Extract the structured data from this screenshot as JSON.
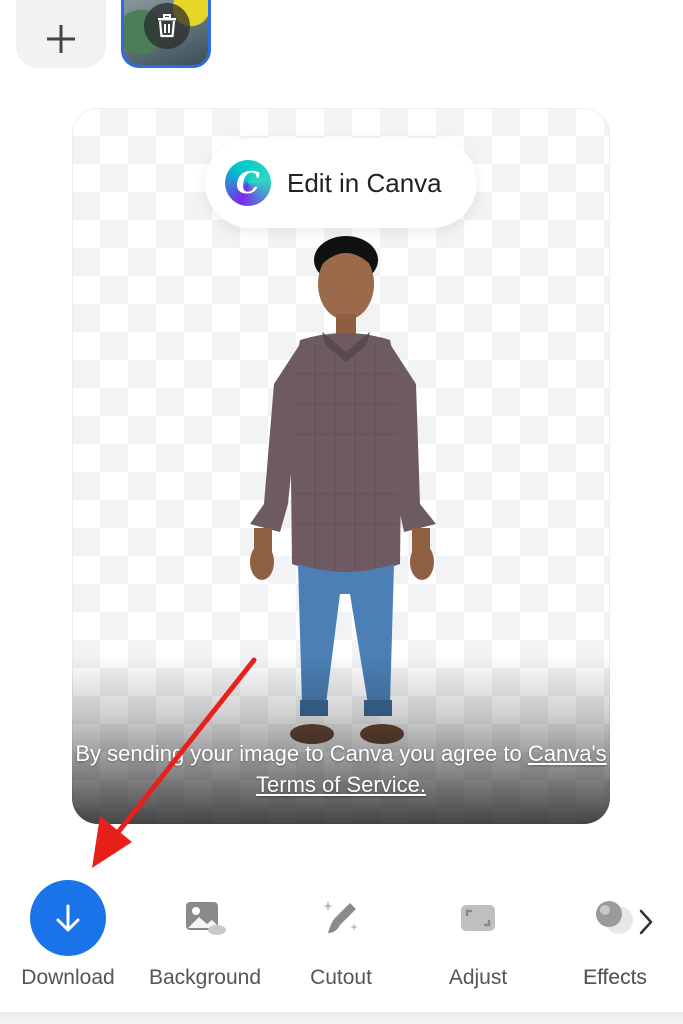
{
  "thumbnails": {
    "add_icon": "plus-icon",
    "delete_icon": "trash-icon"
  },
  "card": {
    "edit_button_label": "Edit in Canva",
    "canva_logo_letter": "C",
    "consent_text": "By sending your image to Canva you agree to ",
    "terms_link": "Canva's Terms of Service."
  },
  "toolbar": {
    "items": [
      {
        "label": "Download",
        "icon": "download-arrow-icon"
      },
      {
        "label": "Background",
        "icon": "image-icon"
      },
      {
        "label": "Cutout",
        "icon": "magic-brush-icon"
      },
      {
        "label": "Adjust",
        "icon": "adjust-frame-icon"
      },
      {
        "label": "Effects",
        "icon": "effects-spheres-icon"
      }
    ],
    "next_icon": "chevron-right-icon"
  },
  "colors": {
    "accent": "#1a73e8",
    "thumb_border": "#2b6de8",
    "annotation_arrow": "#e8201c"
  }
}
